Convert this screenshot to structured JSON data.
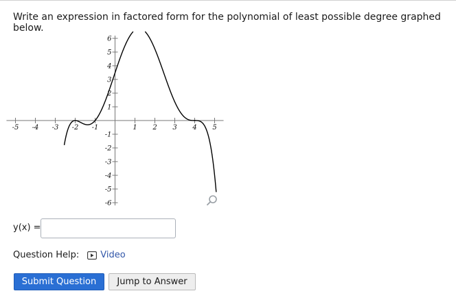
{
  "question": {
    "prompt": "Write an expression in factored form for the polynomial of least possible degree graphed below."
  },
  "graph": {
    "x_ticks": [
      "-5",
      "-4",
      "-3",
      "-2",
      "-1",
      "1",
      "2",
      "3",
      "4",
      "5"
    ],
    "y_ticks": [
      "6",
      "5",
      "4",
      "3",
      "2",
      "1",
      "-1",
      "-2",
      "-3",
      "-4",
      "-5",
      "-6"
    ],
    "zoom_icon": "magnifier-icon",
    "curve_color": "#000000"
  },
  "answer": {
    "label": "y(x) =",
    "value": ""
  },
  "help": {
    "label": "Question Help:",
    "video_icon": "play-video-icon",
    "video_label": "Video",
    "link_color": "#3156a8"
  },
  "buttons": {
    "submit": "Submit Question",
    "jump": "Jump to Answer",
    "primary_color": "#2a6fd4"
  }
}
